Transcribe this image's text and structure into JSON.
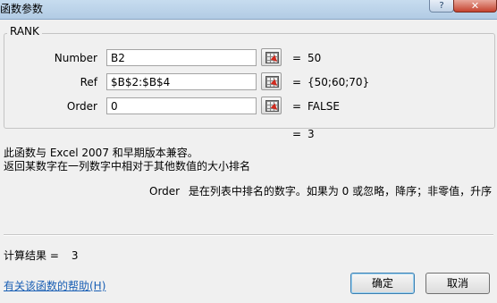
{
  "window": {
    "title": "函数参数",
    "help_glyph": "?",
    "close_glyph": "✕"
  },
  "function_group": {
    "name": "RANK",
    "args": [
      {
        "label": "Number",
        "value": "B2",
        "result": "50"
      },
      {
        "label": "Ref",
        "value": "$B$2:$B$4",
        "result": "{50;60;70}"
      },
      {
        "label": "Order",
        "value": "0",
        "result": "FALSE"
      }
    ]
  },
  "equals": "=",
  "formula_result": "3",
  "description": {
    "compat_line": "此函数与 Excel 2007 和早期版本兼容。",
    "summary_line": "返回某数字在一列数字中相对于其他数值的大小排名"
  },
  "param_help": {
    "name": "Order",
    "text": "是在列表中排名的数字。如果为 0 或忽略，降序；非零值，升序"
  },
  "calc_result": {
    "label": "计算结果 =",
    "value": "3"
  },
  "help_link": "有关该函数的帮助(H)",
  "buttons": {
    "ok": "确定",
    "cancel": "取消"
  }
}
